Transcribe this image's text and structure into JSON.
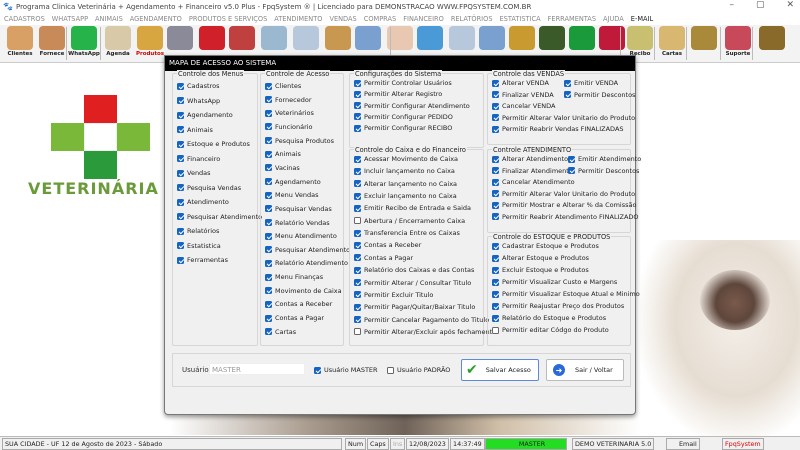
{
  "window": {
    "title": "Programa Clinica Veterinária + Agendamento + Financeiro v5.0 Plus - FpqSystem ® | Licenciado para  DEMONSTRACAO WWW.FPQSYSTEM.COM.BR",
    "minimize": "–",
    "maximize": "▢",
    "close": "✕"
  },
  "menu": [
    "CADASTROS",
    "WHATSAPP",
    "ANIMAIS",
    "AGENDAMENTO",
    "PRODUTOS E SERVIÇOS",
    "ATENDIMENTO",
    "VENDAS",
    "COMPRAS",
    "FINANCEIRO",
    "RELATÓRIOS",
    "ESTATISTICA",
    "FERRAMENTAS",
    "AJUDA"
  ],
  "menu_email": "E-MAIL",
  "toolbar": [
    {
      "label": "Clientes",
      "color": "#d9a066"
    },
    {
      "label": "Fornece",
      "color": "#c98a5a"
    },
    {
      "label": "WhatsApp",
      "color": "#25b34a"
    },
    {
      "label": "Agenda",
      "color": "#d8c9a8"
    },
    {
      "label": "Produtos",
      "color": "#d8a640"
    },
    {
      "label": "",
      "color": "#8a8a98"
    },
    {
      "label": "",
      "color": "#d0202a"
    },
    {
      "label": "",
      "color": "#c04040"
    },
    {
      "label": "",
      "color": "#9ab8d0"
    },
    {
      "label": "",
      "color": "#b8c8dc"
    },
    {
      "label": "",
      "color": "#c89850"
    },
    {
      "label": "",
      "color": "#7aa0d0"
    },
    {
      "label": "",
      "color": "#e8c8b0"
    },
    {
      "label": "",
      "color": "#4a9ad8"
    },
    {
      "label": "",
      "color": "#b8c8dc"
    },
    {
      "label": "",
      "color": "#7aa0d0"
    },
    {
      "label": "",
      "color": "#c89a30"
    },
    {
      "label": "",
      "color": "#3a5a2a"
    },
    {
      "label": "",
      "color": "#1a9a3a"
    },
    {
      "label": "",
      "color": "#c01a3a"
    },
    {
      "label": "Recibo",
      "color": "#c8c070"
    },
    {
      "label": "Cartas",
      "color": "#d8b870"
    },
    {
      "label": "",
      "color": "#a88a3a"
    },
    {
      "label": "Suporte",
      "color": "#c84a5a"
    },
    {
      "label": "",
      "color": "#8a6a2a"
    }
  ],
  "background": {
    "logo_text": "VETERINÁRIA"
  },
  "dialog": {
    "title": "MAPA DE ACESSO AO SISTEMA",
    "groups": [
      {
        "title": "Controle dos Menus",
        "items": [
          [
            "Cadastros",
            true
          ],
          [
            "WhatsApp",
            true
          ],
          [
            "Agendamento",
            true
          ],
          [
            "Animais",
            true
          ],
          [
            "Estoque e Produtos",
            true
          ],
          [
            "Financeiro",
            true
          ],
          [
            "Vendas",
            true
          ],
          [
            "Pesquisa Vendas",
            true
          ],
          [
            "Atendimento",
            true
          ],
          [
            "Pesquisar Atendimento",
            true
          ],
          [
            "Relatórios",
            true
          ],
          [
            "Estatistica",
            true
          ],
          [
            "Ferramentas",
            true
          ]
        ]
      },
      {
        "title": "Controle de Acesso",
        "items": [
          [
            "Clientes",
            true
          ],
          [
            "Fornecedor",
            true
          ],
          [
            "Veterinários",
            true
          ],
          [
            "Funcionário",
            true
          ],
          [
            "Pesquisa Produtos",
            true
          ],
          [
            "Animais",
            true
          ],
          [
            "Vacinas",
            true
          ],
          [
            "Agendamento",
            true
          ],
          [
            "Menu Vendas",
            true
          ],
          [
            "Pesquisar Vendas",
            true
          ],
          [
            "Relatório Vendas",
            true
          ],
          [
            "Menu Atendimento",
            true
          ],
          [
            "Pesquisar Atendimento",
            true
          ],
          [
            "Relatório Atendimento",
            true
          ],
          [
            "Menu Finanças",
            true
          ],
          [
            "Movimento de Caixa",
            true
          ],
          [
            "Contas a Receber",
            true
          ],
          [
            "Contas a Pagar",
            true
          ],
          [
            "Cartas",
            true
          ]
        ]
      },
      {
        "title": "Configurações do Sistema",
        "items": [
          [
            "Permitir Controlar Usuários",
            true
          ],
          [
            "Permitir Alterar Registro",
            true
          ],
          [
            "Permitir Configurar Atendimento",
            true
          ],
          [
            "Permitir Configurar PEDIDO",
            true
          ],
          [
            "Permitir Configurar RECIBO",
            true
          ]
        ]
      },
      {
        "title": "Controle do Caixa e do Financeiro",
        "items": [
          [
            "Acessar Movimento de Caixa",
            true
          ],
          [
            "Incluir lançamento no Caixa",
            true
          ],
          [
            "Alterar lançamento no Caixa",
            true
          ],
          [
            "Excluir lançamento no Caixa",
            true
          ],
          [
            "Emitir Recibo de Entrada e Saida",
            true
          ],
          [
            "Abertura / Encerramento Caixa",
            false
          ],
          [
            "Transferencia Entre os Caixas",
            true
          ],
          [
            "Contas a Receber",
            true
          ],
          [
            "Contas a Pagar",
            true
          ],
          [
            "Relatório dos Caixas e das Contas",
            true
          ],
          [
            "Permitir Alterar / Consultar Titulo",
            true
          ],
          [
            "Permitir Excluir Titulo",
            true
          ],
          [
            "Permitir Pagar/Quitar/Baixar Titulo",
            true
          ],
          [
            "Permitir Cancelar Pagamento do Titulo",
            true
          ],
          [
            "Permitir Alterar/Excluir após fechamento",
            false
          ]
        ]
      },
      {
        "title": "Controle das VENDAS",
        "items": [
          [
            "Alterar VENDA",
            true
          ],
          [
            "Emitir VENDA",
            true
          ],
          [
            "Finalizar VENDA",
            true
          ],
          [
            "Permitir Descontos",
            true
          ],
          [
            "Cancelar VENDA",
            true
          ],
          [
            "Permitir Alterar Valor Unitario do Produto",
            true
          ],
          [
            "Permitir Reabrir Vendas FINALIZADAS",
            true
          ]
        ]
      },
      {
        "title": "Controle ATENDIMENTO",
        "items": [
          [
            "Alterar Atendimento",
            true
          ],
          [
            "Emitir Atendimento",
            true
          ],
          [
            "Finalizar Atendimento",
            true
          ],
          [
            "Permitir Descontos",
            true
          ],
          [
            "Cancelar Atendimento",
            true
          ],
          [
            "Permitir Alterar Valor Unitario do Produto",
            true
          ],
          [
            "Permitir Mostrar e Alterar % da Comissão",
            true
          ],
          [
            "Permitir Reabrir Atendimento FINALIZADO",
            true
          ]
        ]
      },
      {
        "title": "Controle do ESTOQUE e PRODUTOS",
        "items": [
          [
            "Cadastrar Estoque e Produtos",
            true
          ],
          [
            "Alterar Estoque e Produtos",
            true
          ],
          [
            "Excluir Estoque e Produtos",
            true
          ],
          [
            "Permitir Visualizar Custo e Margens",
            true
          ],
          [
            "Permitir Visualizar Estoque Atual e Minimo",
            true
          ],
          [
            "Permitir Reajustar Preço dos Produtos",
            true
          ],
          [
            "Relatório do Estoque e Produtos",
            true
          ],
          [
            "Permitir editar Códgo do Produto",
            false
          ]
        ]
      }
    ],
    "user_label": "Usuário:",
    "user_value": "MASTER",
    "master_label": "Usuário MASTER",
    "master_checked": true,
    "padrao_label": "Usuário PADRÃO",
    "padrao_checked": false,
    "save_label": "Salvar Acesso",
    "exit_label": "Sair / Voltar"
  },
  "status": {
    "city": "SUA CIDADE - UF 12 de Agosto de 2023 - Sábado",
    "num": "Num",
    "caps": "Caps",
    "ins": "Ins",
    "date": "12/08/2023",
    "time": "14:37:49",
    "user": "MASTER",
    "db": "DEMO VETERINARIA 5.0",
    "email": "Email",
    "brand": "FpqSystem"
  }
}
